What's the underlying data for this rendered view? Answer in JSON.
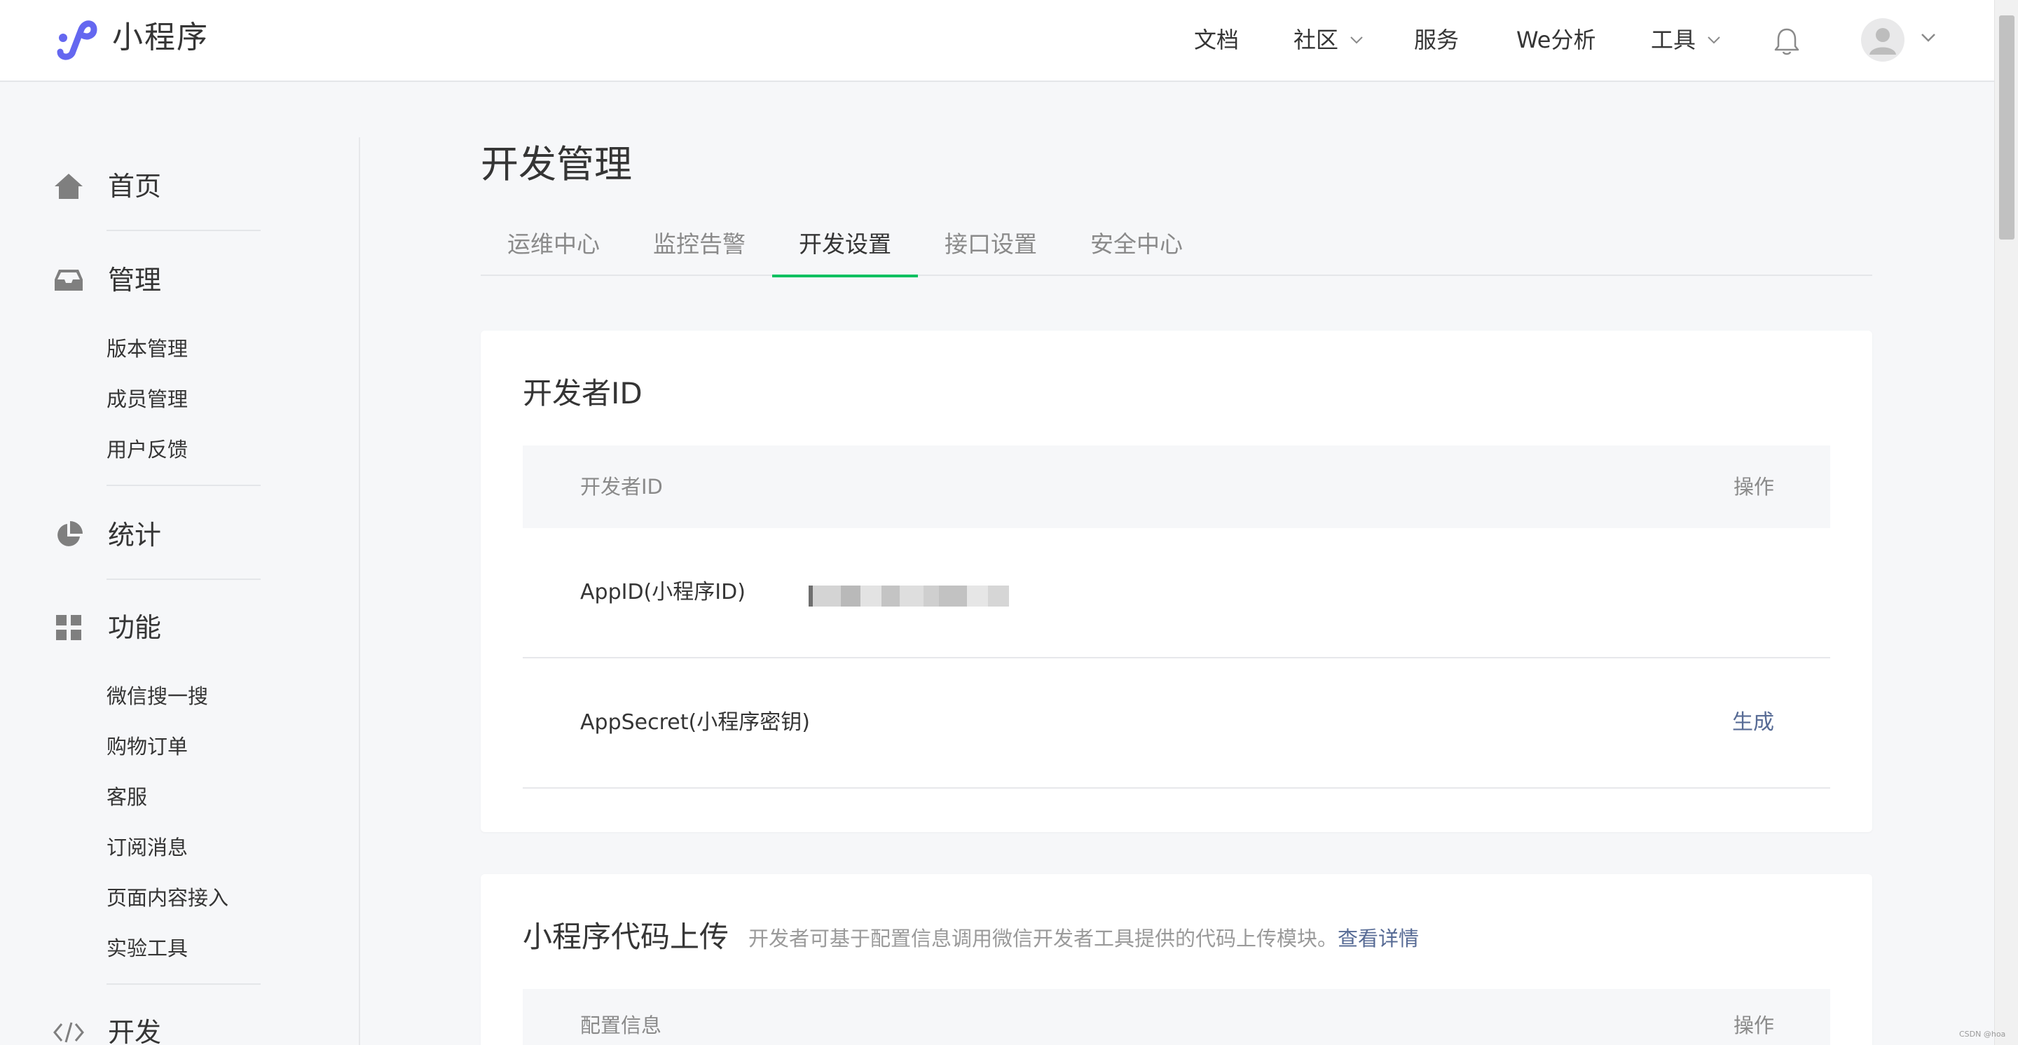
{
  "header": {
    "app_name": "小程序",
    "nav": [
      {
        "label": "文档"
      },
      {
        "label": "社区"
      },
      {
        "label": "服务"
      },
      {
        "label": "We分析"
      },
      {
        "label": "工具"
      }
    ]
  },
  "sidebar": {
    "sections": [
      {
        "label": "首页",
        "icon": "home-icon"
      },
      {
        "label": "管理",
        "icon": "inbox-icon",
        "items": [
          "版本管理",
          "成员管理",
          "用户反馈"
        ]
      },
      {
        "label": "统计",
        "icon": "pie-chart-icon"
      },
      {
        "label": "功能",
        "icon": "grid-icon",
        "items": [
          "微信搜一搜",
          "购物订单",
          "客服",
          "订阅消息",
          "页面内容接入",
          "实验工具"
        ]
      },
      {
        "label": "开发",
        "icon": "code-icon"
      }
    ]
  },
  "main": {
    "title": "开发管理",
    "tabs": [
      "运维中心",
      "监控告警",
      "开发设置",
      "接口设置",
      "安全中心"
    ],
    "active_tab": "开发设置"
  },
  "developer_id_card": {
    "title": "开发者ID",
    "col_name": "开发者ID",
    "col_action": "操作",
    "rows": [
      {
        "label": "AppID(小程序ID)",
        "value_masked": true
      },
      {
        "label": "AppSecret(小程序密钥)",
        "action": "生成"
      }
    ]
  },
  "upload_card": {
    "title": "小程序代码上传",
    "desc": "开发者可基于配置信息调用微信开发者工具提供的代码上传模块。",
    "link": "查看详情",
    "col_name": "配置信息",
    "col_action": "操作"
  },
  "watermark": "CSDN @hoa",
  "colors": {
    "accent_green": "#07c160",
    "link_blue": "#576b95",
    "logo_purple": "#6467f0",
    "page_bg": "#f6f7f9"
  }
}
